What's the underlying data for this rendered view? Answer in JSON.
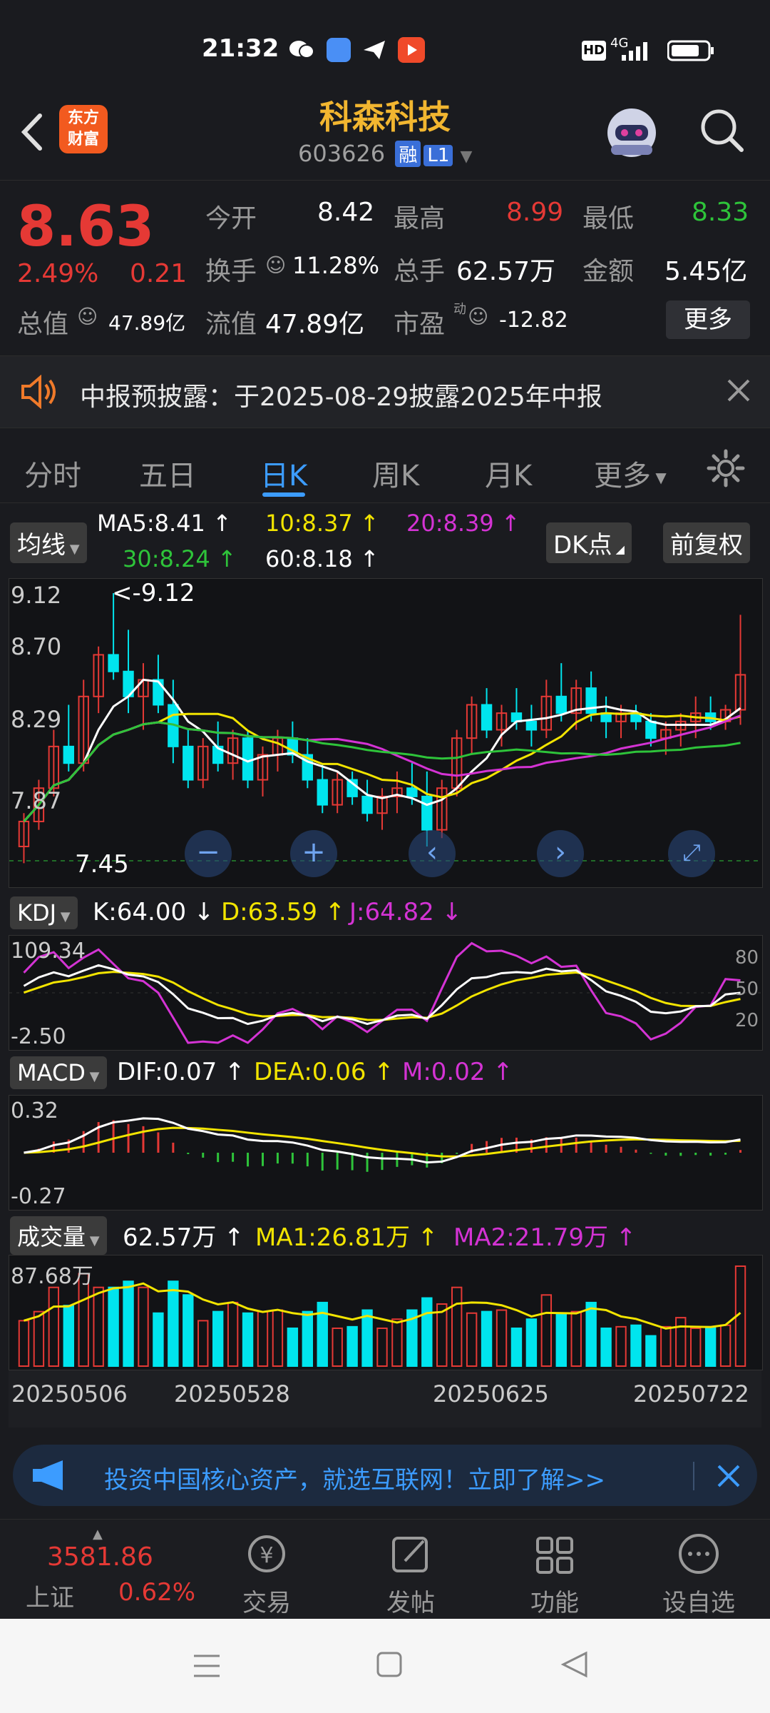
{
  "status_bar": {
    "time": "21:32",
    "network": "4G"
  },
  "header": {
    "back_icon": "chevron-left-icon",
    "logo_text": "东方\n财富",
    "stock_name": "科森科技",
    "stock_code": "603626",
    "tag_rong": "融",
    "tag_level": "L1",
    "search_icon": "search-icon"
  },
  "quote": {
    "price": "8.63",
    "change_pct": "2.49%",
    "change_amt": "0.21",
    "open_label": "今开",
    "open": "8.42",
    "high_label": "最高",
    "high": "8.99",
    "low_label": "最低",
    "low": "8.33",
    "turnover_label": "换手",
    "turnover": "11.28%",
    "volume_label": "总手",
    "volume": "62.57万",
    "amount_label": "金额",
    "amount": "5.45亿",
    "mktcap_label": "总值",
    "mktcap": "47.89亿",
    "float_label": "流值",
    "float": "47.89亿",
    "pe_label": "市盈",
    "pe_sup": "动",
    "pe": "-12.82",
    "more_label": "更多"
  },
  "notice": {
    "text": "中报预披露：于2025-08-29披露2025年中报"
  },
  "tabs": [
    {
      "label": "分时"
    },
    {
      "label": "五日"
    },
    {
      "label": "日K"
    },
    {
      "label": "周K"
    },
    {
      "label": "月K"
    },
    {
      "label": "更多"
    }
  ],
  "kline": {
    "indicator_label": "均线",
    "ma5": "MA5:8.41",
    "ma10": "10:8.37",
    "ma20": "20:8.39",
    "ma30": "30:8.24",
    "ma60": "60:8.18",
    "dk_label": "DK点",
    "adjust_label": "前复权",
    "axis_high": "9.12",
    "axis_mid1": "8.70",
    "axis_mid2": "8.29",
    "axis_mid3": "7.87",
    "max_marker": "<-9.12",
    "min_marker": "7.45"
  },
  "kdj": {
    "label": "KDJ",
    "k": "K:64.00",
    "d": "D:63.59",
    "j": "J:64.82",
    "axis_top": "109.34",
    "axis_bottom": "-2.50",
    "level_80": "80",
    "level_50": "50",
    "level_20": "20"
  },
  "macd": {
    "label": "MACD",
    "dif": "DIF:0.07",
    "dea": "DEA:0.06",
    "m": "M:0.02",
    "axis_top": "0.32",
    "axis_bottom": "-0.27"
  },
  "volume_panel": {
    "label": "成交量",
    "vol": "62.57万",
    "ma1": "MA1:26.81万",
    "ma2": "MA2:21.79万",
    "axis_top": "87.68万",
    "dates": [
      "20250506",
      "20250528",
      "20250625",
      "20250722"
    ]
  },
  "ad": {
    "text": "投资中国核心资产，就选互联网！立即了解>>"
  },
  "bottom_nav": {
    "index_value": "3581.86",
    "index_name": "上证",
    "index_change": "0.62%",
    "trade": "交易",
    "post": "发帖",
    "function": "功能",
    "watchlist": "设自选"
  },
  "colors": {
    "up": "#e53935",
    "down": "#00e5ee",
    "ma5": "#ffffff",
    "ma10": "#f2e400",
    "ma20": "#d433d4",
    "ma30": "#2ec43a",
    "accent": "#3c9cff"
  },
  "chart_data": {
    "type": "candlestick",
    "ylim": [
      7.45,
      9.12
    ],
    "series": [
      {
        "name": "MA5",
        "value": 8.41
      },
      {
        "name": "MA10",
        "value": 8.37
      },
      {
        "name": "MA20",
        "value": 8.39
      },
      {
        "name": "MA30",
        "value": 8.24
      },
      {
        "name": "MA60",
        "value": 8.18
      }
    ],
    "candles": [
      [
        7.6,
        7.8,
        7.5,
        7.75
      ],
      [
        7.75,
        8.0,
        7.7,
        7.95
      ],
      [
        7.95,
        8.3,
        7.9,
        8.2
      ],
      [
        8.2,
        8.45,
        8.05,
        8.1
      ],
      [
        8.1,
        8.6,
        8.05,
        8.5
      ],
      [
        8.5,
        8.8,
        8.4,
        8.75
      ],
      [
        8.75,
        9.12,
        8.6,
        8.65
      ],
      [
        8.65,
        8.9,
        8.4,
        8.5
      ],
      [
        8.5,
        8.7,
        8.3,
        8.6
      ],
      [
        8.6,
        8.75,
        8.4,
        8.45
      ],
      [
        8.45,
        8.6,
        8.1,
        8.2
      ],
      [
        8.2,
        8.3,
        7.95,
        8.0
      ],
      [
        8.0,
        8.25,
        7.95,
        8.2
      ],
      [
        8.2,
        8.35,
        8.05,
        8.1
      ],
      [
        8.1,
        8.3,
        8.0,
        8.25
      ],
      [
        8.25,
        8.3,
        7.95,
        8.0
      ],
      [
        8.0,
        8.2,
        7.9,
        8.15
      ],
      [
        8.15,
        8.3,
        8.05,
        8.25
      ],
      [
        8.25,
        8.35,
        8.1,
        8.15
      ],
      [
        8.15,
        8.25,
        7.95,
        8.0
      ],
      [
        8.0,
        8.1,
        7.8,
        7.85
      ],
      [
        7.85,
        8.05,
        7.8,
        8.0
      ],
      [
        8.0,
        8.05,
        7.85,
        7.9
      ],
      [
        7.9,
        8.0,
        7.75,
        7.8
      ],
      [
        7.8,
        7.95,
        7.7,
        7.9
      ],
      [
        7.9,
        8.05,
        7.8,
        7.95
      ],
      [
        7.95,
        8.1,
        7.85,
        7.9
      ],
      [
        7.9,
        8.05,
        7.6,
        7.7
      ],
      [
        7.7,
        8.0,
        7.65,
        7.95
      ],
      [
        7.95,
        8.3,
        7.9,
        8.25
      ],
      [
        8.25,
        8.5,
        8.15,
        8.45
      ],
      [
        8.45,
        8.55,
        8.25,
        8.3
      ],
      [
        8.3,
        8.45,
        8.2,
        8.4
      ],
      [
        8.4,
        8.55,
        8.3,
        8.35
      ],
      [
        8.35,
        8.45,
        8.2,
        8.3
      ],
      [
        8.3,
        8.6,
        8.25,
        8.5
      ],
      [
        8.5,
        8.7,
        8.35,
        8.4
      ],
      [
        8.4,
        8.6,
        8.3,
        8.55
      ],
      [
        8.55,
        8.65,
        8.35,
        8.4
      ],
      [
        8.4,
        8.5,
        8.25,
        8.35
      ],
      [
        8.35,
        8.45,
        8.25,
        8.4
      ],
      [
        8.4,
        8.45,
        8.3,
        8.35
      ],
      [
        8.35,
        8.4,
        8.2,
        8.25
      ],
      [
        8.25,
        8.35,
        8.15,
        8.3
      ],
      [
        8.3,
        8.4,
        8.2,
        8.35
      ],
      [
        8.35,
        8.5,
        8.25,
        8.4
      ],
      [
        8.4,
        8.5,
        8.3,
        8.35
      ],
      [
        8.35,
        8.45,
        8.3,
        8.42
      ],
      [
        8.42,
        8.99,
        8.33,
        8.63
      ]
    ]
  }
}
